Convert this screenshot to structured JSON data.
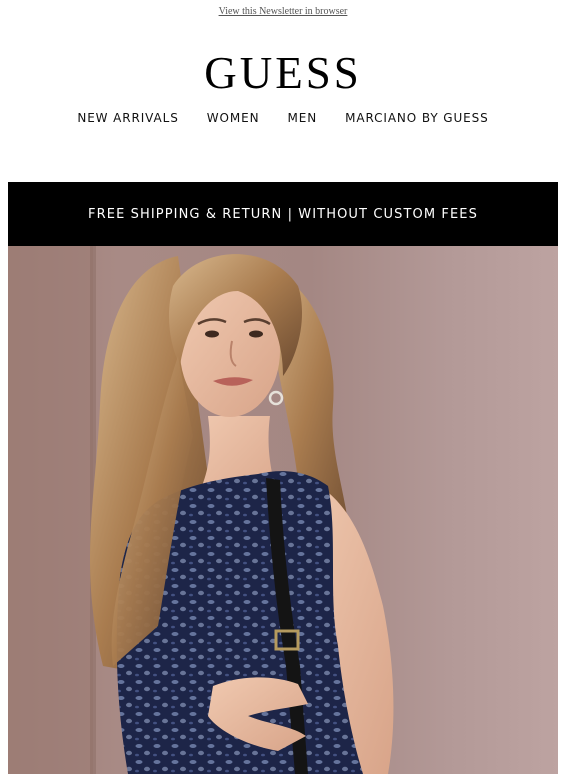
{
  "header": {
    "view_in_browser": "View this Newsletter in browser",
    "logo": "GUESS"
  },
  "nav": {
    "items": [
      "NEW ARRIVALS",
      "WOMEN",
      "MEN",
      "MARCIANO BY GUESS"
    ]
  },
  "banner": {
    "text": "FREE SHIPPING & RETURN | WITHOUT CUSTOM FEES"
  },
  "colors": {
    "banner_bg": "#000000",
    "banner_text": "#ffffff",
    "hero_bg": "#a48783",
    "dress": "#1f2a4d"
  },
  "hero": {
    "image": "model-in-blue-leopard-print-dress-photo"
  }
}
